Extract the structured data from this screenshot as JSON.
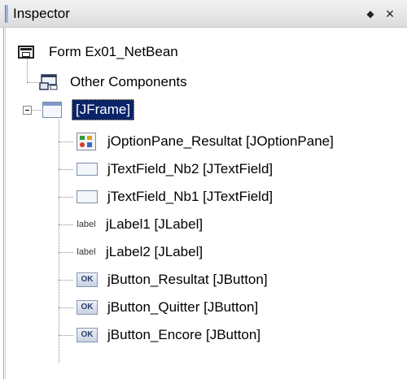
{
  "panel": {
    "title": "Inspector",
    "pin_icon": "diamond-pin-icon",
    "pin_glyph": "◆",
    "close_icon": "close-icon",
    "close_glyph": "×"
  },
  "tree": {
    "root": {
      "label": "Form Ex01_NetBean",
      "icon": "form-icon"
    },
    "other": {
      "label": "Other Components",
      "icon": "components-icon"
    },
    "frame": {
      "label": "[JFrame]",
      "icon": "frame-icon",
      "expanded": true,
      "selected": true
    },
    "children": [
      {
        "label": "jOptionPane_Resultat [JOptionPane]",
        "icon": "option-pane-icon"
      },
      {
        "label": "jTextField_Nb2 [JTextField]",
        "icon": "text-field-icon"
      },
      {
        "label": "jTextField_Nb1 [JTextField]",
        "icon": "text-field-icon"
      },
      {
        "label": "jLabel1 [JLabel]",
        "icon": "label-icon",
        "icon_text": "label"
      },
      {
        "label": "jLabel2 [JLabel]",
        "icon": "label-icon",
        "icon_text": "label"
      },
      {
        "label": "jButton_Resultat [JButton]",
        "icon": "button-icon",
        "icon_text": "OK"
      },
      {
        "label": "jButton_Quitter [JButton]",
        "icon": "button-icon",
        "icon_text": "OK"
      },
      {
        "label": "jButton_Encore [JButton]",
        "icon": "button-icon",
        "icon_text": "OK"
      }
    ]
  },
  "colors": {
    "selection_bg": "#0a246a",
    "selection_text": "#ffffff",
    "header_bg": "#dcdcdc"
  }
}
